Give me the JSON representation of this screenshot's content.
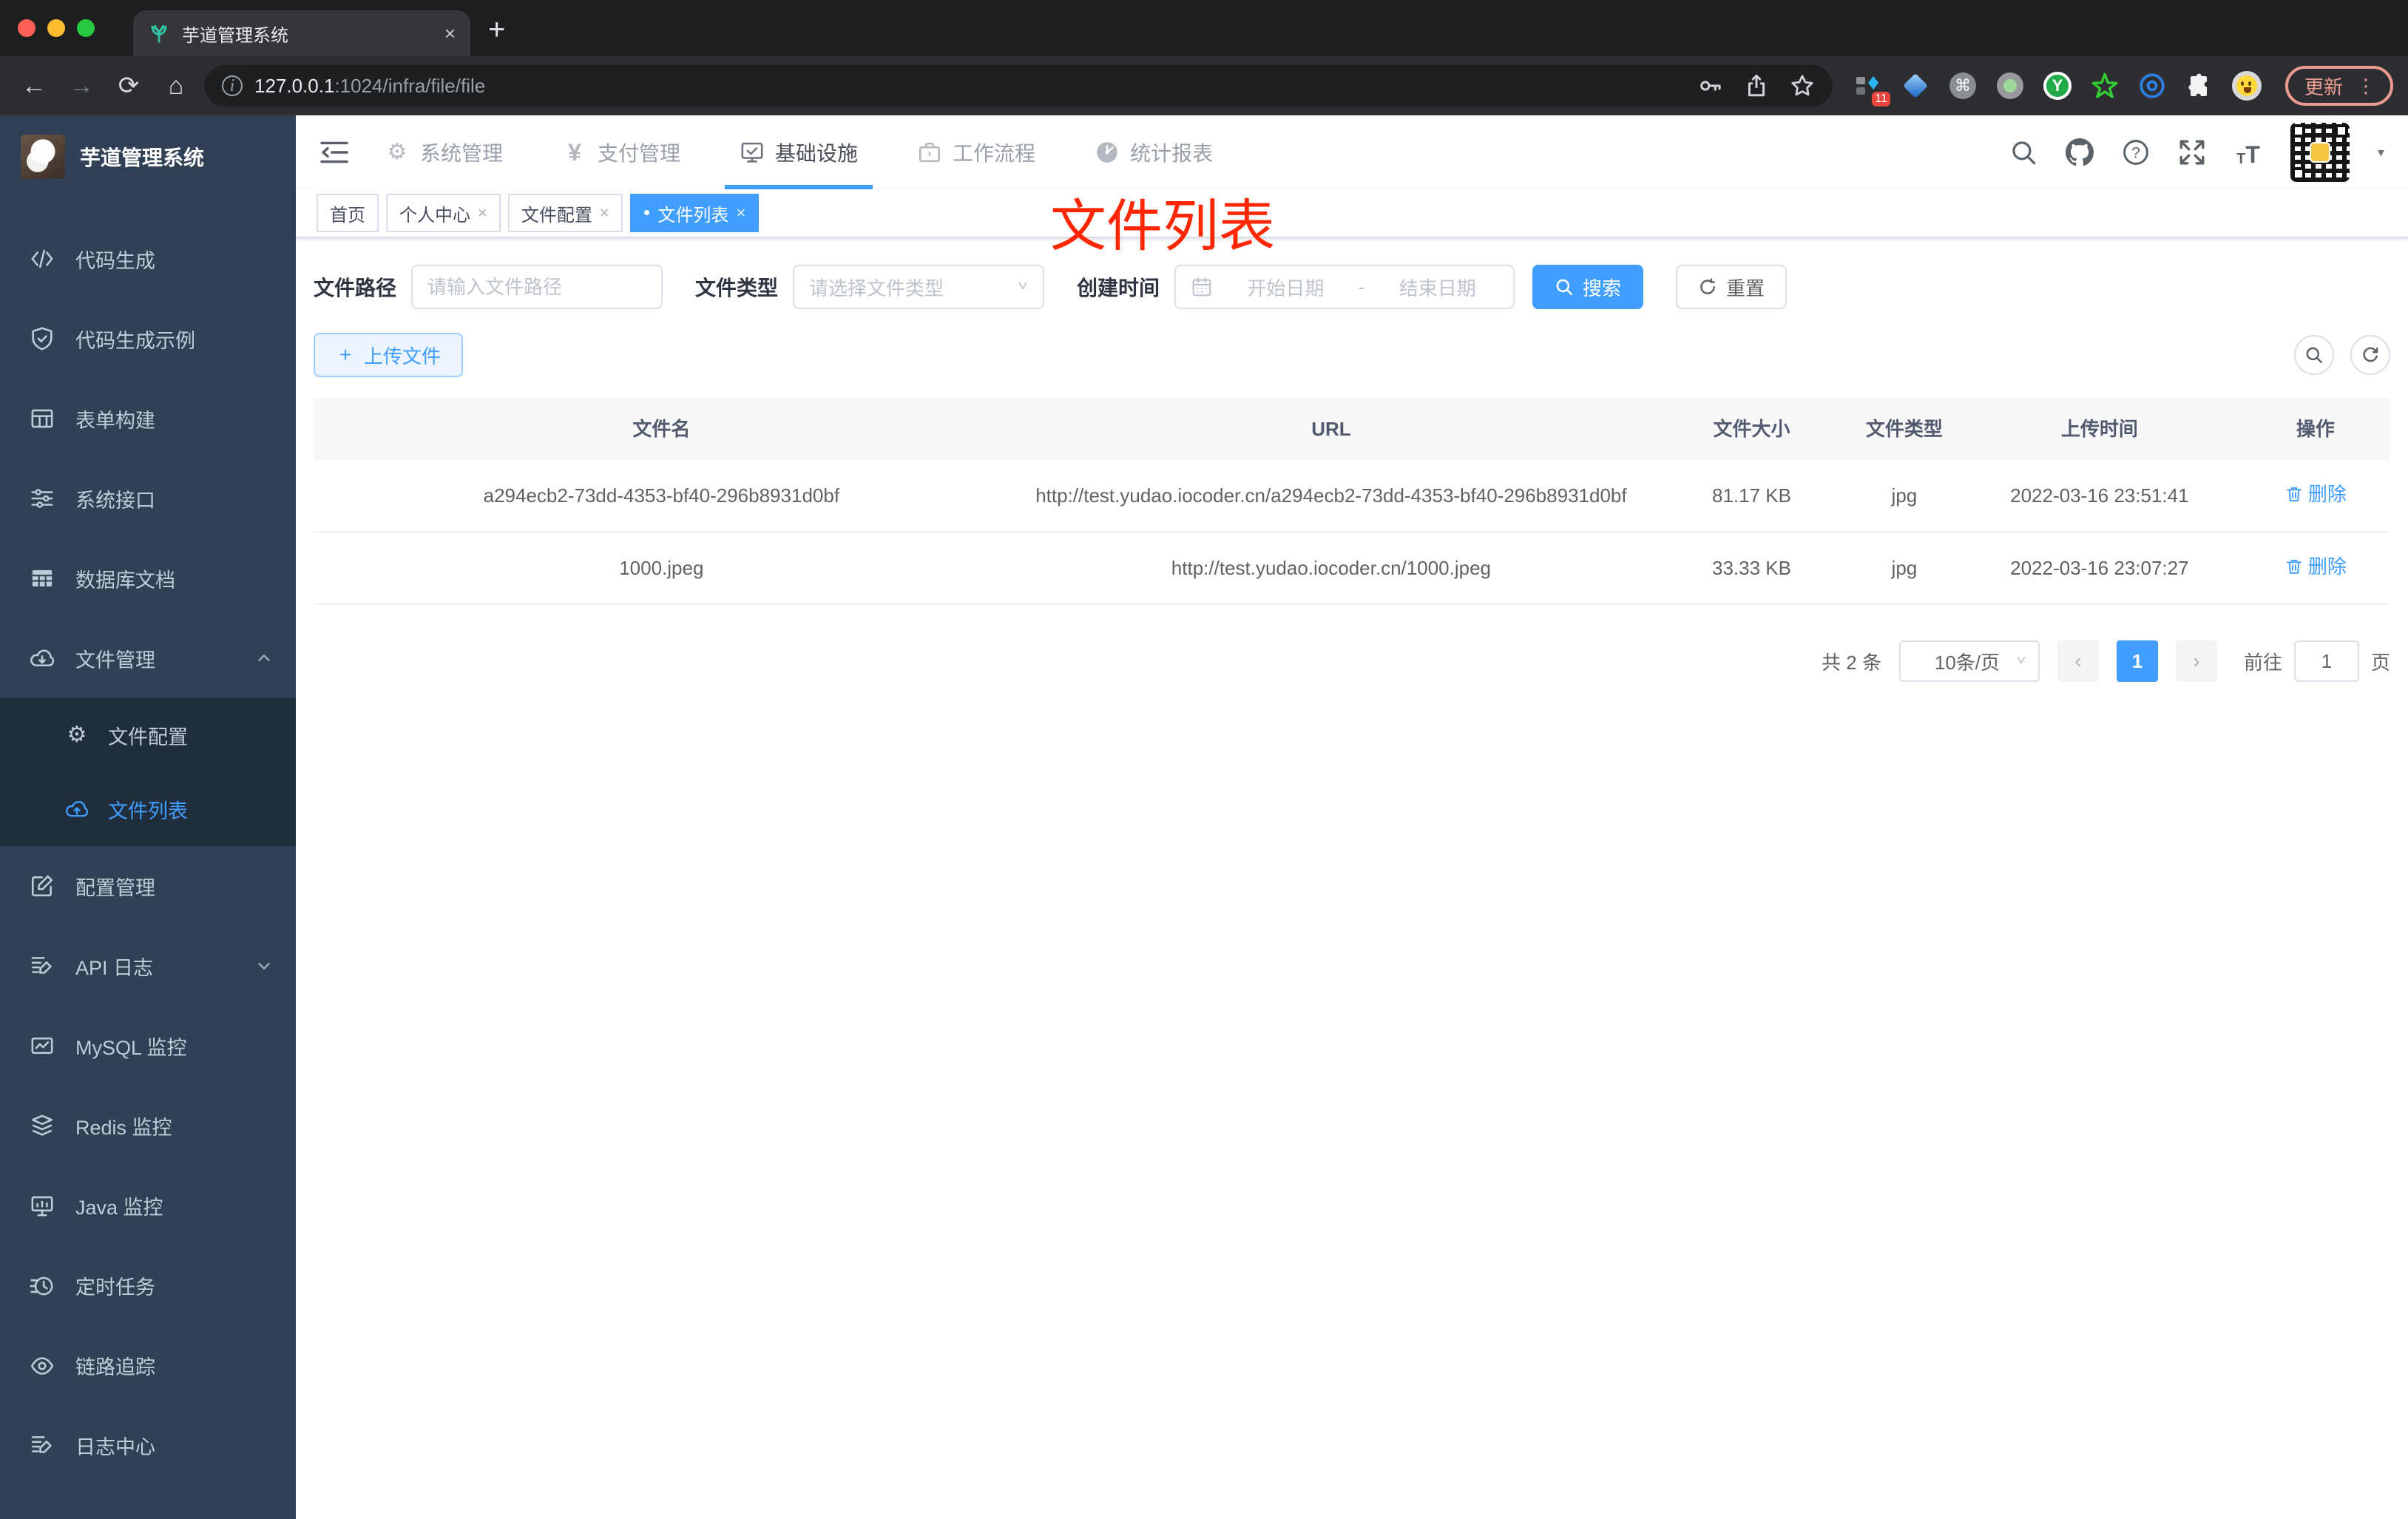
{
  "browser": {
    "tab_title": "芋道管理系统",
    "url_host": "127.0.0.1",
    "url_rest": ":1024/infra/file/file",
    "ext_badge": "11",
    "update_label": "更新"
  },
  "icons": {
    "back": "←",
    "forward": "→",
    "reload": "⟳",
    "home": "⌂",
    "info": "i",
    "command": "⌘",
    "y_logo": "Y",
    "dots": "⋮",
    "plus_tab": "+",
    "yen": "¥",
    "question": "?",
    "font_large": "T",
    "font_small": "T",
    "caret": "▾",
    "gear": "⚙",
    "close": "×",
    "active_dot": "●",
    "chevron_down": "˅",
    "chevron_up": "˄",
    "prev": "‹",
    "next": "›",
    "plus": "+",
    "date_sep": "-"
  },
  "sidebar": {
    "title": "芋道管理系统",
    "items": [
      {
        "label": "代码生成"
      },
      {
        "label": "代码生成示例"
      },
      {
        "label": "表单构建"
      },
      {
        "label": "系统接口"
      },
      {
        "label": "数据库文档"
      }
    ],
    "file_menu": {
      "label": "文件管理",
      "children": [
        {
          "label": "文件配置"
        },
        {
          "label": "文件列表"
        }
      ]
    },
    "items2": [
      {
        "label": "配置管理"
      },
      {
        "label": "API 日志"
      },
      {
        "label": "MySQL 监控"
      },
      {
        "label": "Redis 监控"
      },
      {
        "label": "Java 监控"
      },
      {
        "label": "定时任务"
      },
      {
        "label": "链路追踪"
      },
      {
        "label": "日志中心"
      }
    ]
  },
  "header": {
    "nav": [
      {
        "label": "系统管理"
      },
      {
        "label": "支付管理"
      },
      {
        "label": "基础设施"
      },
      {
        "label": "工作流程"
      },
      {
        "label": "统计报表"
      }
    ]
  },
  "tags": [
    {
      "label": "首页"
    },
    {
      "label": "个人中心"
    },
    {
      "label": "文件配置"
    },
    {
      "label": "文件列表"
    }
  ],
  "annotation": "文件列表",
  "filters": {
    "path_label": "文件路径",
    "path_placeholder": "请输入文件路径",
    "type_label": "文件类型",
    "type_placeholder": "请选择文件类型",
    "date_label": "创建时间",
    "date_start": "开始日期",
    "date_end": "结束日期",
    "search": "搜索",
    "reset": "重置"
  },
  "toolbar": {
    "upload": "上传文件"
  },
  "table": {
    "columns": [
      "文件名",
      "URL",
      "文件大小",
      "文件类型",
      "上传时间",
      "操作"
    ],
    "rows": [
      {
        "name": "a294ecb2-73dd-4353-bf40-296b8931d0bf",
        "url": "http://test.yudao.iocoder.cn/a294ecb2-73dd-4353-bf40-296b8931d0bf",
        "size": "81.17 KB",
        "type": "jpg",
        "time": "2022-03-16 23:51:41",
        "action": "删除"
      },
      {
        "name": "1000.jpeg",
        "url": "http://test.yudao.iocoder.cn/1000.jpeg",
        "size": "33.33 KB",
        "type": "jpg",
        "time": "2022-03-16 23:07:27",
        "action": "删除"
      }
    ]
  },
  "pagination": {
    "total": "共 2 条",
    "per_page": "10条/页",
    "page": "1",
    "goto": "前往",
    "page_suffix": "页"
  },
  "colors": {
    "accent": "#409eff",
    "sidebar_bg": "#304156",
    "submenu_bg": "#1f2d3d",
    "annotation": "#ff2600",
    "update": "#ee9d93"
  }
}
